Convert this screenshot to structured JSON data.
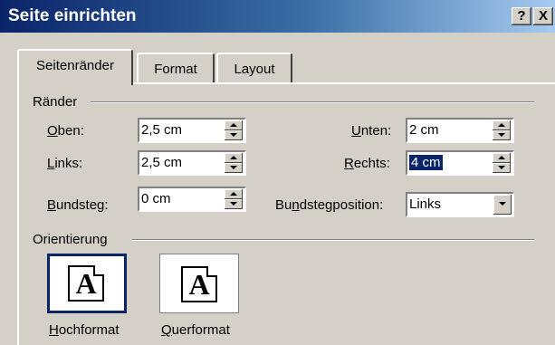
{
  "window": {
    "title": "Seite einrichten",
    "help_label": "?",
    "close_label": "X"
  },
  "tabs": [
    {
      "label": "Seitenränder",
      "active": true
    },
    {
      "label": "Format",
      "active": false
    },
    {
      "label": "Layout",
      "active": false
    }
  ],
  "margins": {
    "group_label": "Ränder",
    "top": {
      "label_u": "O",
      "label_rest": "ben:",
      "value": "2,5 cm"
    },
    "left": {
      "label_u": "L",
      "label_rest": "inks:",
      "value": "2,5 cm"
    },
    "gutter": {
      "label_u": "B",
      "label_rest": "undsteg:",
      "value": "0 cm"
    },
    "bottom": {
      "label_u": "U",
      "label_rest": "nten:",
      "value": "2 cm"
    },
    "right": {
      "label_u": "R",
      "label_rest": "echts:",
      "value": "4 cm"
    },
    "gutter_position": {
      "label_pre": "Bu",
      "label_u": "n",
      "label_rest": "dstegposition:",
      "value": "Links"
    }
  },
  "orientation": {
    "group_label": "Orientierung",
    "portrait": {
      "label_u": "H",
      "label_rest": "ochformat",
      "icon_glyph": "A"
    },
    "landscape": {
      "label_u": "Q",
      "label_rest": "uerformat",
      "icon_glyph": "A"
    }
  }
}
